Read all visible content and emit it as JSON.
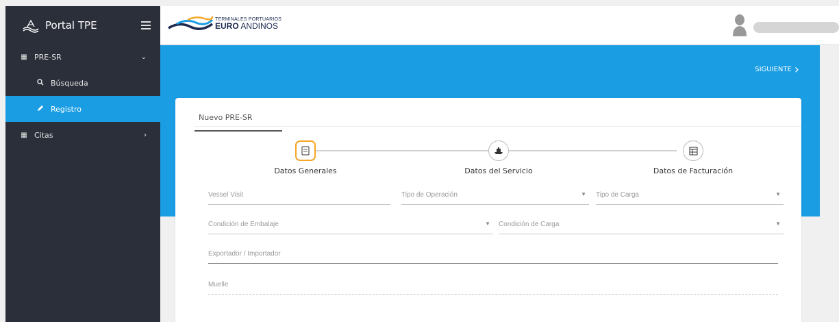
{
  "app": {
    "title": "Portal TPE"
  },
  "sidebar": {
    "items": [
      {
        "label": "PRE-SR",
        "icon": "grid-icon"
      },
      {
        "label": "Búsqueda",
        "icon": "search-icon"
      },
      {
        "label": "Registro",
        "icon": "pencil-icon",
        "active": true
      },
      {
        "label": "Citas",
        "icon": "grid-icon"
      }
    ]
  },
  "header": {
    "brand_line1": "TERMINALES PORTUARIOS",
    "brand_bold": "EURO",
    "brand_rest": " ANDINOS"
  },
  "actions": {
    "next_label": "SIGUIENTE"
  },
  "tab": {
    "label": "Nuevo PRE-SR"
  },
  "steps": [
    {
      "label": "Datos Generales",
      "icon": "document-icon",
      "active": true
    },
    {
      "label": "Datos del Servicio",
      "icon": "ship-icon",
      "active": false
    },
    {
      "label": "Datos de Facturación",
      "icon": "invoice-icon",
      "active": false
    }
  ],
  "form": {
    "vessel_visit": "Vessel Visit",
    "tipo_operacion": "Tipo de Operación",
    "tipo_carga": "Tipo de Carga",
    "condicion_embalaje": "Condición de Embalaje",
    "condicion_carga": "Condición de Carga",
    "exportador": "Exportador / Importador",
    "muelle": "Muelle"
  },
  "colors": {
    "accent": "#1a9de3",
    "sidebar": "#2b2f3a",
    "active_step": "#f5a623"
  }
}
